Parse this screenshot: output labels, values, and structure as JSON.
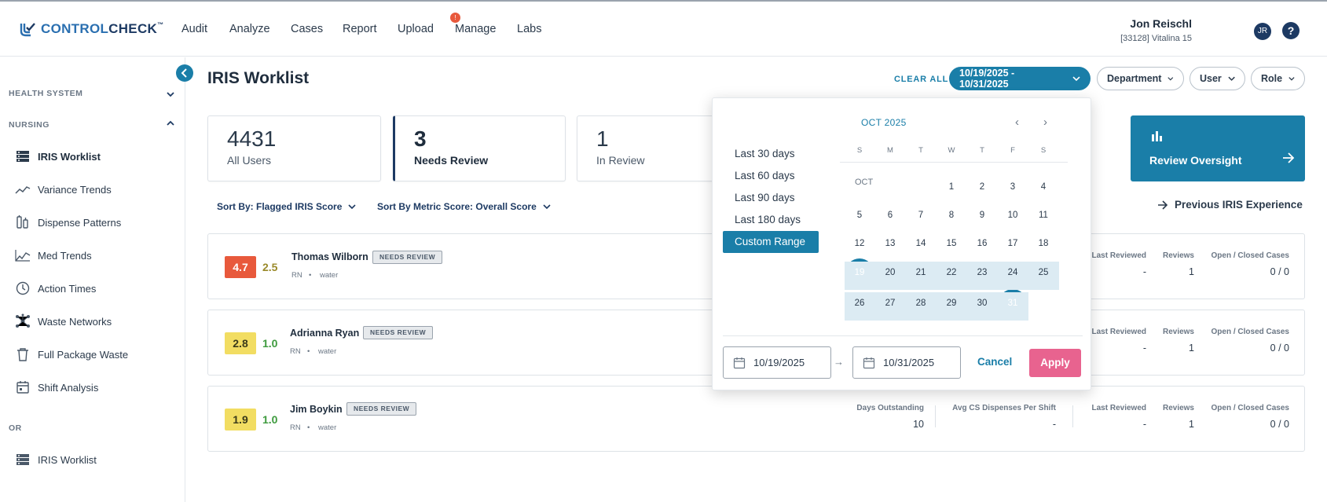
{
  "app": {
    "logo_prefix": "CONTROL",
    "logo_suffix": "CHECK",
    "logo_tm": "™"
  },
  "nav": {
    "items": [
      "Audit",
      "Analyze",
      "Cases",
      "Report",
      "Upload",
      "Manage",
      "Labs"
    ],
    "manage_badge": "!"
  },
  "user": {
    "name": "Jon Reischl",
    "sub": "[33128] Vitalina 15",
    "initials": "JR",
    "help": "?"
  },
  "sidebar": {
    "section_health": "HEALTH SYSTEM",
    "section_nursing": "NURSING",
    "section_or": "OR",
    "items": [
      {
        "label": "IRIS Worklist",
        "icon": "worklist-icon"
      },
      {
        "label": "Variance Trends",
        "icon": "trend-line-icon"
      },
      {
        "label": "Dispense Patterns",
        "icon": "dispense-icon"
      },
      {
        "label": "Med Trends",
        "icon": "med-trend-icon"
      },
      {
        "label": "Action Times",
        "icon": "clock-icon"
      },
      {
        "label": "Waste Networks",
        "icon": "network-icon"
      },
      {
        "label": "Full Package Waste",
        "icon": "trash-icon"
      },
      {
        "label": "Shift Analysis",
        "icon": "calendar-icon"
      }
    ],
    "or_items": [
      {
        "label": "IRIS Worklist",
        "icon": "worklist-icon"
      }
    ]
  },
  "main": {
    "title": "IRIS Worklist",
    "clear_all": "CLEAR ALL",
    "filters": {
      "date_range": "10/19/2025 - 10/31/2025",
      "department": "Department",
      "user": "User",
      "role": "Role"
    },
    "cards": [
      {
        "num": "4431",
        "label": "All Users"
      },
      {
        "num": "3",
        "label": "Needs Review"
      },
      {
        "num": "1",
        "label": "In Review"
      }
    ],
    "oversight": "Review Oversight",
    "sort_flagged": "Sort By: Flagged IRIS Score",
    "sort_metric": "Sort By Metric Score: Overall Score",
    "previous_experience": "Previous IRIS Experience"
  },
  "rows": [
    {
      "score1": "4.7",
      "score2": "2.5",
      "name": "Thomas Wilborn",
      "badge": "NEEDS REVIEW",
      "role": "RN",
      "dot": "•",
      "dept": "water",
      "last_reviewed_h": "Last Reviewed",
      "last_reviewed": "-",
      "reviews_h": "Reviews",
      "reviews": "1",
      "cases_h": "Open / Closed Cases",
      "cases": "0 / 0"
    },
    {
      "score1": "2.8",
      "score2": "1.0",
      "name": "Adrianna Ryan",
      "badge": "NEEDS REVIEW",
      "role": "RN",
      "dot": "•",
      "dept": "water",
      "last_reviewed_h": "Last Reviewed",
      "last_reviewed": "-",
      "reviews_h": "Reviews",
      "reviews": "1",
      "cases_h": "Open / Closed Cases",
      "cases": "0 / 0"
    },
    {
      "score1": "1.9",
      "score2": "1.0",
      "name": "Jim Boykin",
      "badge": "NEEDS REVIEW",
      "role": "RN",
      "dot": "•",
      "dept": "water",
      "days_h": "Days Outstanding",
      "days": "10",
      "avg_h": "Avg CS Dispenses Per Shift",
      "avg": "-",
      "last_reviewed_h": "Last Reviewed",
      "last_reviewed": "-",
      "reviews_h": "Reviews",
      "reviews": "1",
      "cases_h": "Open / Closed Cases",
      "cases": "0 / 0"
    }
  ],
  "datepicker": {
    "presets": [
      "Last 30 days",
      "Last 60 days",
      "Last 90 days",
      "Last 180 days",
      "Custom Range"
    ],
    "month_title": "OCT 2025",
    "month_label": "OCT",
    "prev": "‹",
    "next": "›",
    "dow": [
      "S",
      "M",
      "T",
      "W",
      "T",
      "F",
      "S"
    ],
    "start": "10/19/2025",
    "end": "10/31/2025",
    "arrow": "→",
    "cancel": "Cancel",
    "apply": "Apply"
  },
  "colors": {
    "accent": "#1a7ea8",
    "navy": "#1d3a63",
    "apply": "#e8638f",
    "red_score": "#e8593c",
    "yellow_score": "#f2dd62"
  }
}
